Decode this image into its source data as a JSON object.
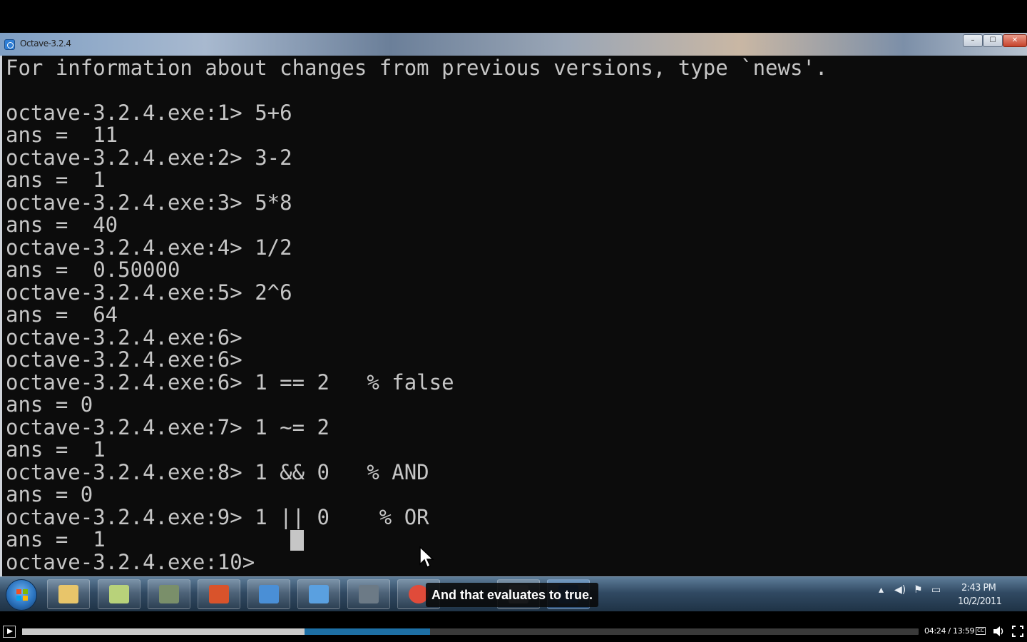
{
  "window": {
    "title": "Octave-3.2.4",
    "minimize_label": "–",
    "maximize_label": "☐",
    "close_label": "✕"
  },
  "console": {
    "lines": [
      "For information about changes from previous versions, type `news'.",
      "",
      "octave-3.2.4.exe:1> 5+6",
      "ans =  11",
      "octave-3.2.4.exe:2> 3-2",
      "ans =  1",
      "octave-3.2.4.exe:3> 5*8",
      "ans =  40",
      "octave-3.2.4.exe:4> 1/2",
      "ans =  0.50000",
      "octave-3.2.4.exe:5> 2^6",
      "ans =  64",
      "octave-3.2.4.exe:6>",
      "octave-3.2.4.exe:6>",
      "octave-3.2.4.exe:6> 1 == 2   % false",
      "ans = 0",
      "octave-3.2.4.exe:7> 1 ~= 2",
      "ans =  1",
      "octave-3.2.4.exe:8> 1 && 0   % AND",
      "ans = 0",
      "octave-3.2.4.exe:9> 1 || 0    % OR",
      "ans =  1",
      "octave-3.2.4.exe:10>"
    ]
  },
  "taskbar": {
    "items": [
      {
        "icon": "folder-icon",
        "color": "#e8c56a"
      },
      {
        "icon": "notes-icon",
        "color": "#b8d27a"
      },
      {
        "icon": "tool-icon",
        "color": "#7a8f6a"
      },
      {
        "icon": "powerpoint-icon",
        "color": "#d9532b"
      },
      {
        "icon": "network-icon",
        "color": "#4a8fd6"
      },
      {
        "icon": "remote-desktop-icon",
        "color": "#5aa0e0"
      },
      {
        "icon": "camera-icon",
        "color": "#6c7a86"
      },
      {
        "icon": "chrome-icon",
        "color": "#e04b3a"
      },
      {
        "icon": "app-icon",
        "color": "#8a97a6"
      },
      {
        "icon": "octave-icon",
        "color": "#2f6fbf"
      }
    ],
    "clock_time": "2:43 PM",
    "clock_date": "10/2/2011"
  },
  "caption": {
    "text": "And that evaluates to true."
  },
  "player": {
    "current_time": "04:24",
    "total_time": "13:59",
    "played_fraction": 0.315,
    "buffered_fraction": 0.455,
    "cc_label": "CC"
  }
}
